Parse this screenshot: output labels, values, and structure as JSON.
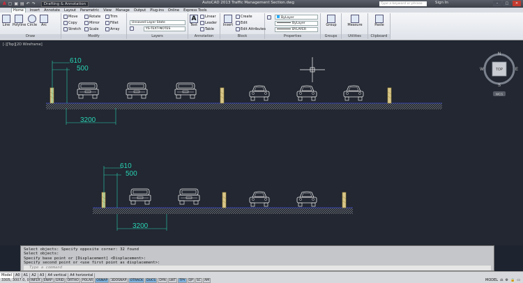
{
  "app": {
    "workspace": "Drafting & Annotation",
    "title": "AutoCAD 2013   Traffic Management Section.dwg",
    "search_placeholder": "Type a keyword or phrase",
    "signin": "Sign In"
  },
  "tabs": [
    "Home",
    "Insert",
    "Annotate",
    "Layout",
    "Parametric",
    "View",
    "Manage",
    "Output",
    "Plug-ins",
    "Online",
    "Express Tools"
  ],
  "ribbon": {
    "draw": {
      "label": "Draw",
      "line": "Line",
      "polyline": "Polyline",
      "circle": "Circle",
      "arc": "Arc"
    },
    "modify": {
      "label": "Modify",
      "move": "Move",
      "rotate": "Rotate",
      "trim": "Trim",
      "copy": "Copy",
      "mirror": "Mirror",
      "fillet": "Fillet",
      "stretch": "Stretch",
      "scale": "Scale",
      "array": "Array"
    },
    "layers": {
      "label": "Layers",
      "layer_state": "Unsaved Layer State",
      "current_layer": "YS-TEXT-NOTES"
    },
    "annotation": {
      "label": "Annotation",
      "text": "Text",
      "linear": "Linear",
      "leader": "Leader",
      "table": "Table"
    },
    "block": {
      "label": "Block",
      "insert": "Insert",
      "create": "Create",
      "edit": "Edit",
      "edit_attributes": "Edit Attributes"
    },
    "properties": {
      "label": "Properties",
      "color": "ByLayer",
      "linetype": "ByLayer",
      "lineweight": "BYLAYER"
    },
    "groups": {
      "label": "Groups",
      "group": "Group"
    },
    "utilities": {
      "label": "Utilities",
      "measure": "Measure"
    },
    "clipboard": {
      "label": "Clipboard",
      "paste": "Paste"
    }
  },
  "viewport": {
    "label": "[-][Top][2D Wireframe]",
    "viewcube_top": "TOP",
    "compass": {
      "n": "N",
      "s": "S",
      "e": "E",
      "w": "W"
    },
    "wcs": "WCS",
    "dims_top": {
      "d1": "610",
      "d2": "500",
      "d3": "3200"
    },
    "dims_bottom": {
      "d1": "610",
      "d2": "500",
      "d3": "3200"
    }
  },
  "command": {
    "history": [
      "Select objects: Specify opposite corner: 32 found",
      "Select objects:",
      "Specify base point or [Displacement] <Displacement>:",
      "Specify second point or <use first point as displacement>:"
    ],
    "placeholder": "Type a command"
  },
  "status": {
    "layout_tabs": [
      "Model",
      "A0",
      "A1",
      "A2",
      "A3",
      "A4 vertical",
      "A4 horizontal"
    ],
    "coords": "3305, 3007.0, 0",
    "toggles": [
      {
        "label": "INFER",
        "on": false
      },
      {
        "label": "SNAP",
        "on": false
      },
      {
        "label": "GRID",
        "on": false
      },
      {
        "label": "ORTHO",
        "on": false
      },
      {
        "label": "POLAR",
        "on": false
      },
      {
        "label": "OSNAP",
        "on": true
      },
      {
        "label": "3DOSNAP",
        "on": false
      },
      {
        "label": "OTRACK",
        "on": true
      },
      {
        "label": "DUCS",
        "on": true
      },
      {
        "label": "DYN",
        "on": false
      },
      {
        "label": "LWT",
        "on": false
      },
      {
        "label": "TPY",
        "on": true
      },
      {
        "label": "QP",
        "on": false
      },
      {
        "label": "SC",
        "on": false
      },
      {
        "label": "AM",
        "on": false
      }
    ],
    "model": "MODEL"
  }
}
